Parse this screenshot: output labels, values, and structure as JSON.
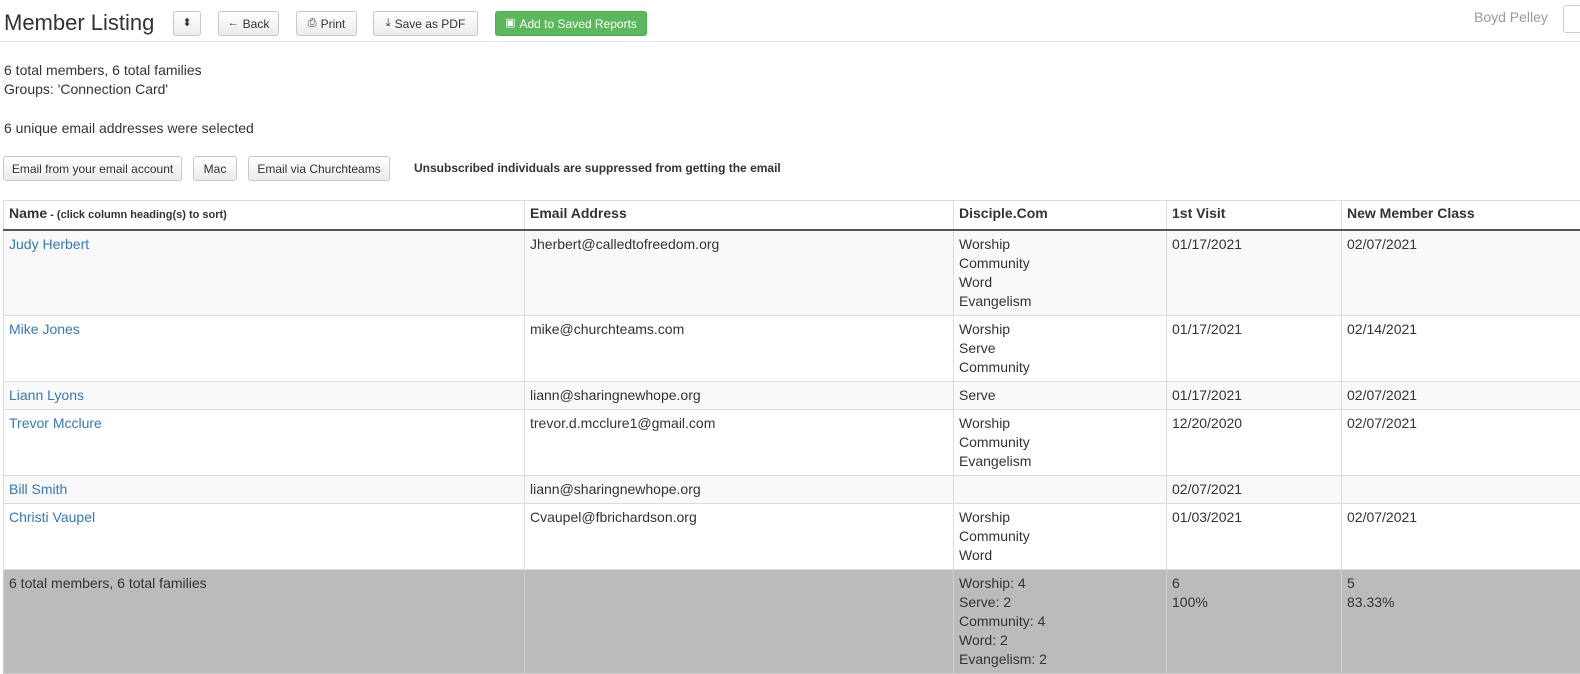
{
  "header": {
    "title": "Member Listing",
    "sort_toggle_icon": "sort-icon",
    "back_label": "Back",
    "print_label": "Print",
    "save_pdf_label": "Save as PDF",
    "add_saved_label": "Add to Saved Reports",
    "user_name": "Boyd Pelley"
  },
  "summary": {
    "totals": "6 total members, 6 total families",
    "groups": "Groups: 'Connection Card'",
    "emails": "6 unique email addresses were selected"
  },
  "email_actions": {
    "from_account": "Email from your email account",
    "mac": "Mac",
    "via_churchteams": "Email via Churchteams",
    "note": "Unsubscribed individuals are suppressed from getting the email"
  },
  "table": {
    "columns": {
      "name": "Name",
      "name_hint": " - (click column heading(s) to sort)",
      "email": "Email Address",
      "disciple": "Disciple.Com",
      "first_visit": "1st Visit",
      "new_member": "New Member Class"
    },
    "rows": [
      {
        "name": "Judy Herbert",
        "email": "Jherbert@calledtofreedom.org",
        "disciple": [
          "Worship",
          "Community",
          "Word",
          "Evangelism"
        ],
        "first_visit": "01/17/2021",
        "new_member": "02/07/2021"
      },
      {
        "name": "Mike Jones",
        "email": "mike@churchteams.com",
        "disciple": [
          "Worship",
          "Serve",
          "Community"
        ],
        "first_visit": "01/17/2021",
        "new_member": "02/14/2021"
      },
      {
        "name": "Liann Lyons",
        "email": "liann@sharingnewhope.org",
        "disciple": [
          "Serve"
        ],
        "first_visit": "01/17/2021",
        "new_member": "02/07/2021"
      },
      {
        "name": "Trevor Mcclure",
        "email": "trevor.d.mcclure1@gmail.com",
        "disciple": [
          "Worship",
          "Community",
          "Evangelism"
        ],
        "first_visit": "12/20/2020",
        "new_member": "02/07/2021"
      },
      {
        "name": "Bill Smith",
        "email": "liann@sharingnewhope.org",
        "disciple": [],
        "first_visit": "02/07/2021",
        "new_member": ""
      },
      {
        "name": "Christi Vaupel",
        "email": "Cvaupel@fbrichardson.org",
        "disciple": [
          "Worship",
          "Community",
          "Word"
        ],
        "first_visit": "01/03/2021",
        "new_member": "02/07/2021"
      }
    ],
    "footer": {
      "label": "6 total members, 6 total families",
      "disciple": [
        "Worship: 4",
        "Serve: 2",
        "Community: 4",
        "Word: 2",
        "Evangelism: 2"
      ],
      "first_visit": [
        "6",
        "100%"
      ],
      "new_member": [
        "5",
        "83.33%"
      ]
    }
  }
}
